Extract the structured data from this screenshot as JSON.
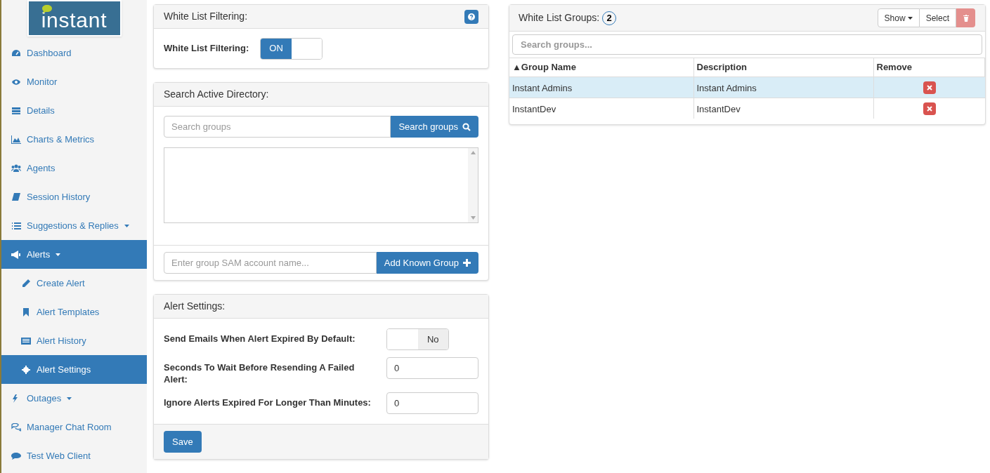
{
  "logo": {
    "text": "instant"
  },
  "sidebar": {
    "items": [
      {
        "kind": "link",
        "label": "Dashboard",
        "selected": false
      },
      {
        "kind": "link",
        "label": "Monitor",
        "selected": false
      },
      {
        "kind": "link",
        "label": "Details",
        "selected": false
      },
      {
        "kind": "link",
        "label": "Charts & Metrics",
        "selected": false
      },
      {
        "kind": "link",
        "label": "Agents",
        "selected": false
      },
      {
        "kind": "link",
        "label": "Session History",
        "selected": false
      },
      {
        "kind": "menu",
        "label": "Suggestions & Replies",
        "selected": false
      },
      {
        "kind": "menu",
        "label": "Alerts",
        "selected": true,
        "children": [
          {
            "label": "Create Alert",
            "selected": false
          },
          {
            "label": "Alert Templates",
            "selected": false
          },
          {
            "label": "Alert History",
            "selected": false
          },
          {
            "label": "Alert Settings",
            "selected": true
          }
        ]
      },
      {
        "kind": "menu",
        "label": "Outages",
        "selected": false
      },
      {
        "kind": "link",
        "label": "Manager Chat Room",
        "selected": false
      },
      {
        "kind": "link",
        "label": "Test Web Client",
        "selected": false
      }
    ]
  },
  "white_list_filtering": {
    "title": "White List Filtering:",
    "field_label": "White List Filtering:",
    "toggle": {
      "label": "ON",
      "on": true
    }
  },
  "search_active_directory": {
    "title": "Search Active Directory:",
    "search_placeholder": "Search groups",
    "search_button": "Search groups",
    "sam_placeholder": "Enter group SAM account name...",
    "add_button": "Add Known Group"
  },
  "alert_settings": {
    "title": "Alert Settings:",
    "rows": [
      {
        "kind": "toggle",
        "label": "Send Emails When Alert Expired By Default:",
        "toggle": {
          "label": "No",
          "on": false
        }
      },
      {
        "kind": "input",
        "label": "Seconds To Wait Before Resending A Failed Alert:",
        "value": "0"
      },
      {
        "kind": "input",
        "label": "Ignore Alerts Expired For Longer Than Minutes:",
        "value": "0"
      }
    ],
    "save_button": "Save"
  },
  "white_list_groups": {
    "title": "White List Groups:",
    "count": "2",
    "show_button": "Show",
    "select_button": "Select",
    "search_placeholder": "Search groups...",
    "columns": [
      "▲Group Name",
      "Description",
      "Remove"
    ],
    "rows": [
      {
        "group_name": "Instant Admins",
        "description": "Instant Admins",
        "selected": true
      },
      {
        "group_name": "InstantDev",
        "description": "InstantDev",
        "selected": false
      }
    ]
  }
}
